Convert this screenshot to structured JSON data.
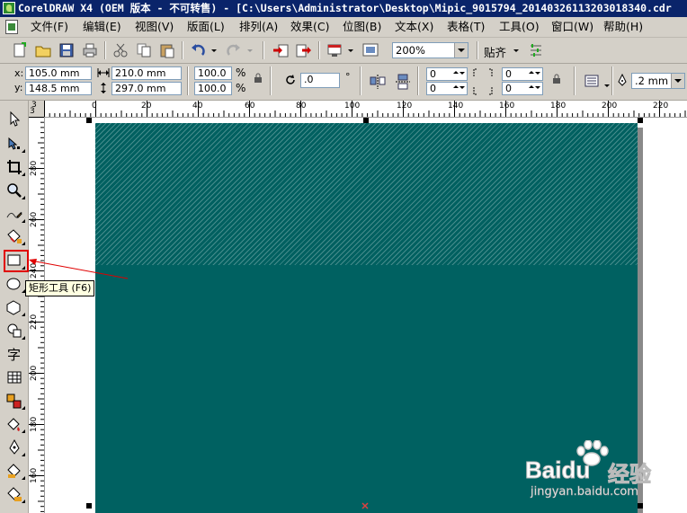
{
  "window": {
    "title": "CorelDRAW X4 (OEM 版本 - 不可转售) - [C:\\Users\\Administrator\\Desktop\\Mipic_9015794_20140326113203018340.cdr"
  },
  "menu": [
    "文件(F)",
    "编辑(E)",
    "视图(V)",
    "版面(L)",
    "排列(A)",
    "效果(C)",
    "位图(B)",
    "文本(X)",
    "表格(T)",
    "工具(O)",
    "窗口(W)",
    "帮助(H)"
  ],
  "toolbar": {
    "zoom_value": "200%",
    "snap_label": "贴齐"
  },
  "properties": {
    "x_label": "x:",
    "x_value": "105.0 mm",
    "y_label": "y:",
    "y_value": "148.5 mm",
    "width_value": "210.0 mm",
    "height_value": "297.0 mm",
    "scale_x": "100.0",
    "scale_y": "100.0",
    "percent": "%",
    "rotation_value": ".0",
    "degree": "°",
    "corner_tl": "0",
    "corner_bl": "0",
    "corner_tr": "0",
    "corner_br": "0",
    "outline_width": ".2 mm"
  },
  "ruler": {
    "h_ticks": [
      "0",
      "20",
      "40",
      "60",
      "80",
      "100",
      "120",
      "140",
      "160",
      "180",
      "200",
      "220"
    ],
    "v_ticks": [
      "280",
      "260",
      "240",
      "220",
      "200",
      "180",
      "160"
    ],
    "corner_top": "3",
    "corner_left": "3"
  },
  "tooltip": "矩形工具 (F6)",
  "watermark": {
    "brand": "Baidu",
    "brand_suffix": "经验",
    "url": "jingyan.baidu.com"
  },
  "colors": {
    "page_fill": "#006161",
    "highlight": "#e00000",
    "titlebar": "#0a246a"
  }
}
